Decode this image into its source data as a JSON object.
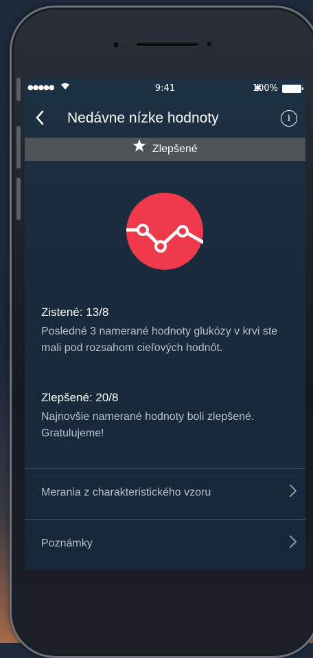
{
  "status_bar": {
    "signal": "●●●●●",
    "time": "9:41",
    "bluetooth": "✱",
    "battery": "100%"
  },
  "nav": {
    "back_icon": "chevron-left",
    "title": "Nedávne nízke hodnoty",
    "info_icon": "info"
  },
  "banner": {
    "label": "Zlepšené",
    "icon": "star"
  },
  "badge": {
    "icon": "trend-line",
    "color": "#f0394a"
  },
  "detected": {
    "heading": "Zistené: 13/8",
    "text": "Posledné 3 namerané hodnoty glukózy v krvi ste mali pod rozsahom cieľových hodnôt."
  },
  "improved": {
    "heading": "Zlepšené: 20/8",
    "text": "Najnovšie namerané hodnoty boli zlepšené. Gratulujeme!"
  },
  "rows": [
    {
      "label": "Merania z charakteristického vzoru"
    },
    {
      "label": "Poznámky"
    }
  ]
}
